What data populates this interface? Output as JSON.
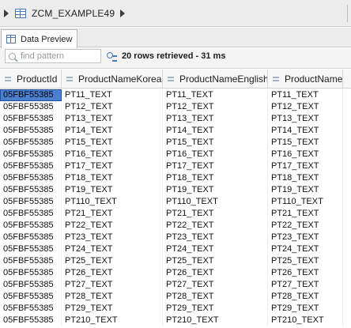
{
  "breadcrumb": {
    "name": "ZCM_EXAMPLE49"
  },
  "tabs": [
    {
      "label": "Data Preview",
      "icon": "table-icon",
      "active": true
    }
  ],
  "toolbar": {
    "search_placeholder": "find pattern",
    "status": "20 rows retrieved - 31 ms"
  },
  "table": {
    "columns": [
      "ProductId",
      "ProductNameKorean",
      "ProductNameEnglish",
      "ProductName"
    ],
    "rows": [
      [
        "05FBF55385",
        "PT11_TEXT",
        "PT11_TEXT",
        "PT11_TEXT"
      ],
      [
        "05FBF55385",
        "PT12_TEXT",
        "PT12_TEXT",
        "PT12_TEXT"
      ],
      [
        "05FBF55385",
        "PT13_TEXT",
        "PT13_TEXT",
        "PT13_TEXT"
      ],
      [
        "05FBF55385",
        "PT14_TEXT",
        "PT14_TEXT",
        "PT14_TEXT"
      ],
      [
        "05FBF55385",
        "PT15_TEXT",
        "PT15_TEXT",
        "PT15_TEXT"
      ],
      [
        "05FBF55385",
        "PT16_TEXT",
        "PT16_TEXT",
        "PT16_TEXT"
      ],
      [
        "05FBF55385",
        "PT17_TEXT",
        "PT17_TEXT",
        "PT17_TEXT"
      ],
      [
        "05FBF55385",
        "PT18_TEXT",
        "PT18_TEXT",
        "PT18_TEXT"
      ],
      [
        "05FBF55385",
        "PT19_TEXT",
        "PT19_TEXT",
        "PT19_TEXT"
      ],
      [
        "05FBF55385",
        "PT110_TEXT",
        "PT110_TEXT",
        "PT110_TEXT"
      ],
      [
        "05FBF55385",
        "PT21_TEXT",
        "PT21_TEXT",
        "PT21_TEXT"
      ],
      [
        "05FBF55385",
        "PT22_TEXT",
        "PT22_TEXT",
        "PT22_TEXT"
      ],
      [
        "05FBF55385",
        "PT23_TEXT",
        "PT23_TEXT",
        "PT23_TEXT"
      ],
      [
        "05FBF55385",
        "PT24_TEXT",
        "PT24_TEXT",
        "PT24_TEXT"
      ],
      [
        "05FBF55385",
        "PT25_TEXT",
        "PT25_TEXT",
        "PT25_TEXT"
      ],
      [
        "05FBF55385",
        "PT26_TEXT",
        "PT26_TEXT",
        "PT26_TEXT"
      ],
      [
        "05FBF55385",
        "PT27_TEXT",
        "PT27_TEXT",
        "PT27_TEXT"
      ],
      [
        "05FBF55385",
        "PT28_TEXT",
        "PT28_TEXT",
        "PT28_TEXT"
      ],
      [
        "05FBF55385",
        "PT29_TEXT",
        "PT29_TEXT",
        "PT29_TEXT"
      ],
      [
        "05FBF55385",
        "PT210_TEXT",
        "PT210_TEXT",
        "PT210_TEXT"
      ]
    ],
    "selected_cell": {
      "row": 0,
      "col": 0
    }
  },
  "colors": {
    "selection": "#4b7fd0",
    "accent_icon": "#4a78b4"
  }
}
